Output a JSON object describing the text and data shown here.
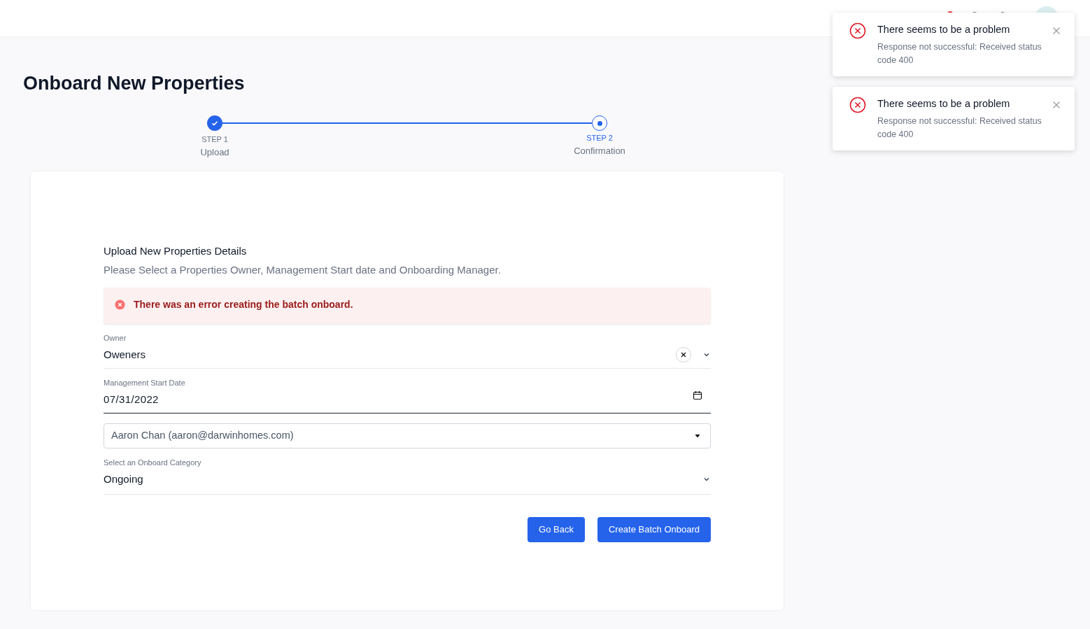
{
  "page_title": "Onboard New Properties",
  "stepper": [
    {
      "step": "STEP 1",
      "label": "Upload",
      "completed": true,
      "selected": false
    },
    {
      "step": "STEP 2",
      "label": "Confirmation",
      "completed": false,
      "selected": true
    }
  ],
  "form": {
    "title": "Upload New Properties Details",
    "subtitle": "Please Select a Properties Owner, Management Start date and Onboarding Manager.",
    "error": "There was an error creating the batch onboard.",
    "fields": [
      {
        "kind": "combo",
        "label": "Owner",
        "value": "Oweners"
      },
      {
        "kind": "date",
        "label": "Management Start Date",
        "value": "07/31/2022"
      },
      {
        "kind": "select",
        "value": "Aaron Chan (aaron@darwinhomes.com)"
      },
      {
        "kind": "dropdown",
        "label": "Select an Onboard Category",
        "value": "Ongoing"
      }
    ],
    "buttons": [
      "Go Back",
      "Create Batch Onboard"
    ]
  },
  "toasts": [
    {
      "title": "There seems to be a problem",
      "message": "Response not successful: Received status code 400"
    },
    {
      "title": "There seems to be a problem",
      "message": "Response not successful: Received status code 400"
    }
  ]
}
